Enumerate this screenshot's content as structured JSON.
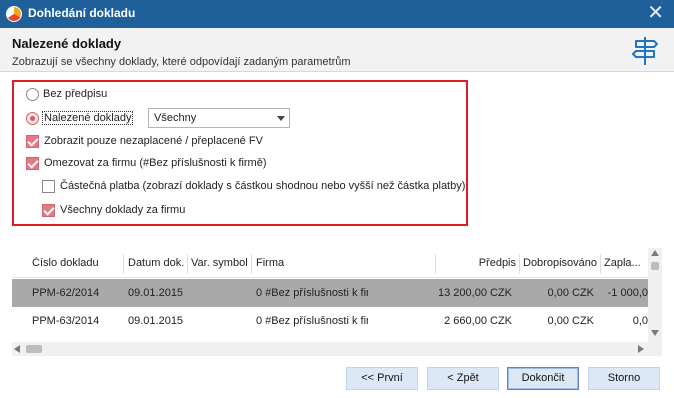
{
  "window": {
    "title": "Dohledání dokladu",
    "close_symbol": "✕"
  },
  "header": {
    "title": "Nalezené doklady",
    "subtitle": "Zobrazují se všechny doklady, které odpovídají zadaným parametrům"
  },
  "filters": {
    "radio_no_prescription": {
      "label": "Bez předpisu",
      "checked": false
    },
    "radio_found_documents": {
      "label": "Nalezené doklady",
      "checked": true
    },
    "document_select": {
      "value": "Všechny"
    },
    "check_unpaid_only": {
      "label": "Zobrazit pouze nezaplacené / přeplacené FV",
      "checked": true
    },
    "check_limit_company": {
      "label": "Omezovat za firmu (#Bez příslušnosti k firmě)",
      "checked": true
    },
    "check_partial_payment": {
      "label": "Částečná platba (zobrazí doklady s částkou shodnou nebo vyšší než částka platby)",
      "checked": false
    },
    "check_all_documents": {
      "label": "Všechny doklady za firmu",
      "checked": true
    }
  },
  "table": {
    "columns": [
      "Číslo dokladu",
      "Datum dok.",
      "Var. symbol",
      "Firma",
      "Předpis",
      "Dobropisováno",
      "Zapla..."
    ],
    "rows": [
      {
        "number": "PPM-62/2014",
        "date": "09.01.2015",
        "var_symbol": "",
        "firm": "0 #Bez příslušnosti k fir",
        "prescription": "13 200,00 CZK",
        "credited": "0,00 CZK",
        "paid": "-1 000,0",
        "selected": true
      },
      {
        "number": "PPM-63/2014",
        "date": "09.01.2015",
        "var_symbol": "",
        "firm": "0 #Bez příslušnosti k fir",
        "prescription": "2 660,00 CZK",
        "credited": "0,00 CZK",
        "paid": "0,0",
        "selected": false
      }
    ]
  },
  "buttons": {
    "first": "<< První",
    "back": "< Zpět",
    "finish": "Dokončit",
    "cancel": "Storno"
  },
  "colors": {
    "titlebar": "#1f5f9a",
    "highlight_border": "#e01b24",
    "selected_row": "#a9a9a9",
    "button": "#dde8f6"
  }
}
